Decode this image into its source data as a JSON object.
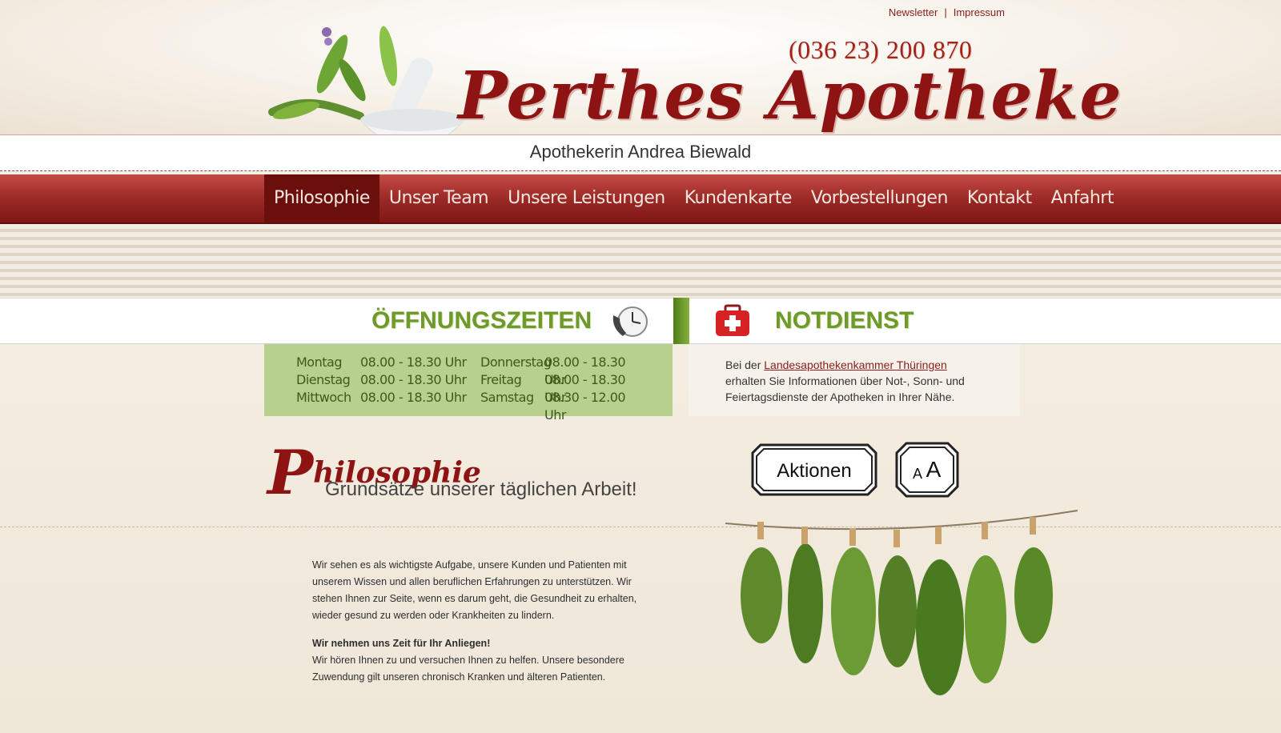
{
  "top_links": {
    "newsletter": "Newsletter",
    "separator": "|",
    "impressum": "Impressum"
  },
  "header": {
    "phone": "(036 23) 200 870",
    "logo": "Perthes Apotheke",
    "subtitle": "Apothekerin Andrea Biewald"
  },
  "nav": {
    "items": [
      {
        "label": "Philosophie",
        "active": true
      },
      {
        "label": "Unser Team"
      },
      {
        "label": "Unsere Leistungen"
      },
      {
        "label": "Kundenkarte"
      },
      {
        "label": "Vorbestellungen"
      },
      {
        "label": "Kontakt"
      },
      {
        "label": "Anfahrt"
      }
    ]
  },
  "hours": {
    "title": "ÖFFNUNGSZEITEN",
    "rows": [
      {
        "day1": "Montag",
        "time1": "08.00 - 18.30 Uhr",
        "day2": "Donnerstag",
        "time2": "08.00 - 18.30 Uhr"
      },
      {
        "day1": "Dienstag",
        "time1": "08.00 - 18.30 Uhr",
        "day2": "Freitag",
        "time2": "08.00 - 18.30 Uhr"
      },
      {
        "day1": "Mittwoch",
        "time1": "08.00 - 18.30 Uhr",
        "day2": "Samstag",
        "time2": "08.30 - 12.00 Uhr"
      }
    ]
  },
  "notdienst": {
    "title": "NOTDIENST",
    "text_before": "Bei der ",
    "link": "Landesapothekenkammer Thüringen",
    "text_after": " erhalten Sie Informationen über Not-, Sonn- und Feiertagsdienste der Apotheken in Ihrer Nähe."
  },
  "philosophy": {
    "title_cap": "P",
    "title_rest": "hilosophie",
    "subtitle": "Grundsätze unserer täglichen Arbeit!",
    "para1": "Wir sehen es als wichtigste Aufgabe, unsere Kunden und Patienten mit unserem Wissen und allen beruflichen Erfahrungen zu unterstützen. Wir stehen Ihnen zur Seite, wenn es darum geht, die Gesundheit zu erhalten, wieder gesund zu werden oder Krankheiten zu lindern.",
    "para2_bold": "Wir nehmen uns Zeit für Ihr Anliegen!",
    "para2": "Wir hören Ihnen zu und versuchen Ihnen zu helfen. Unsere besondere Zuwendung gilt unseren chronisch Kranken und älteren Patienten."
  },
  "buttons": {
    "aktionen": "Aktionen",
    "font_small": "A",
    "font_large": "A"
  },
  "colors": {
    "brand_red": "#8e1414",
    "nav_red": "#9c2a26",
    "green": "#6e9a2a",
    "hours_bg": "#b8d08d"
  }
}
